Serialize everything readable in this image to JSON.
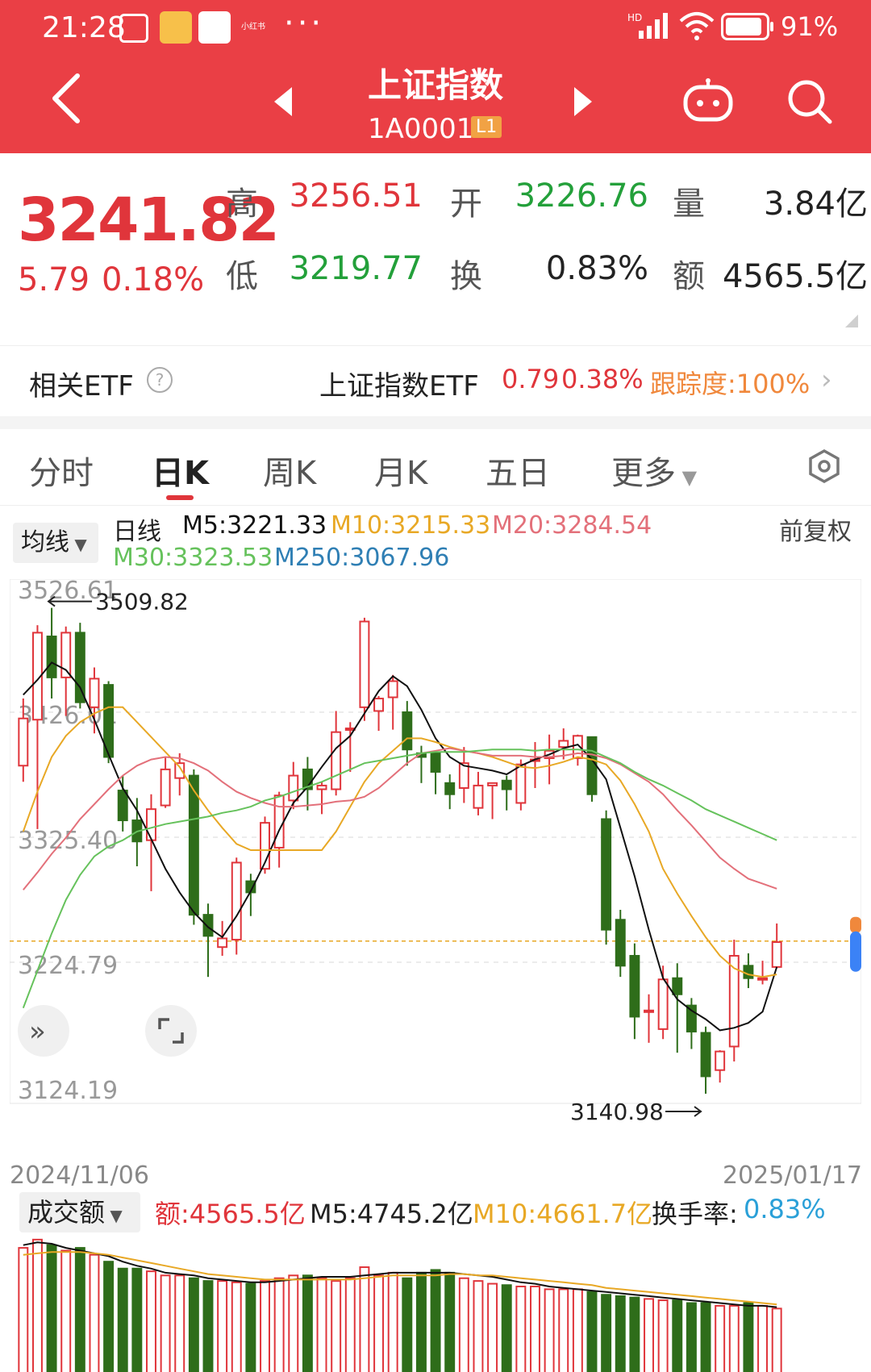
{
  "status_bar": {
    "time": "21:28",
    "battery": "91%",
    "network": "HD",
    "app_label": "小红书"
  },
  "header": {
    "title": "上证指数",
    "code": "1A0001",
    "level": "L1"
  },
  "quote": {
    "price": "3241.82",
    "change": "5.79",
    "change_pct": "0.18%",
    "high_label": "高",
    "high": "3256.51",
    "open_label": "开",
    "open": "3226.76",
    "vol_label": "量",
    "volume": "3.84亿",
    "low_label": "低",
    "low": "3219.77",
    "turnover_label": "换",
    "turnover": "0.83%",
    "amount_label": "额",
    "amount": "4565.5亿"
  },
  "etf": {
    "label": "相关ETF",
    "name": "上证指数ETF",
    "price": "0.79",
    "pct": "0.38%",
    "tracking": "跟踪度:100%"
  },
  "tabs": [
    "分时",
    "日K",
    "周K",
    "月K",
    "五日",
    "更多"
  ],
  "ma_legend": {
    "selector": "均线",
    "period": "日线",
    "m5": "M5:3221.33",
    "m10": "M10:3215.33",
    "m20": "M20:3284.54",
    "m30": "M30:3323.53",
    "m250": "M250:3067.96",
    "adjust": "前复权"
  },
  "colors": {
    "up": "#e0353b",
    "down": "#2e6d1a",
    "m5": "#111111",
    "m10": "#e8a825",
    "m20": "#e3707a",
    "m30": "#66c25c",
    "m250": "#2f7fb4"
  },
  "chart_data": {
    "type": "candlestick",
    "y_ticks": [
      "3526.61",
      "3426.01",
      "3325.40",
      "3224.79",
      "3124.19"
    ],
    "ylim": [
      3124.19,
      3526.61
    ],
    "high_annotation": "3509.82",
    "low_annotation": "3140.98",
    "last_price": 3241.82,
    "x_start": "2024/11/06",
    "x_end": "2025/01/17",
    "candles": [
      [
        3383,
        3421,
        3370,
        3437
      ],
      [
        3420,
        3490,
        3332,
        3496
      ],
      [
        3487,
        3454,
        3437,
        3510
      ],
      [
        3454,
        3490,
        3423,
        3495
      ],
      [
        3490,
        3434,
        3429,
        3498
      ],
      [
        3430,
        3453,
        3409,
        3462
      ],
      [
        3448,
        3390,
        3385,
        3451
      ],
      [
        3363,
        3339,
        3330,
        3375
      ],
      [
        3339,
        3322,
        3302,
        3357
      ],
      [
        3323,
        3348,
        3282,
        3360
      ],
      [
        3351,
        3380,
        3349,
        3390
      ],
      [
        3373,
        3385,
        3359,
        3393
      ],
      [
        3375,
        3263,
        3255,
        3380
      ],
      [
        3263,
        3246,
        3213,
        3272
      ],
      [
        3237,
        3244,
        3230,
        3258
      ],
      [
        3243,
        3305,
        3231,
        3309
      ],
      [
        3290,
        3281,
        3262,
        3296
      ],
      [
        3300,
        3337,
        3296,
        3342
      ],
      [
        3317,
        3359,
        3301,
        3362
      ],
      [
        3355,
        3375,
        3348,
        3386
      ],
      [
        3380,
        3364,
        3347,
        3390
      ],
      [
        3364,
        3367,
        3344,
        3370
      ],
      [
        3364,
        3410,
        3359,
        3427
      ],
      [
        3412,
        3413,
        3378,
        3418
      ],
      [
        3430,
        3499,
        3419,
        3502
      ],
      [
        3427,
        3437,
        3411,
        3439
      ],
      [
        3438,
        3451,
        3412,
        3456
      ],
      [
        3426,
        3396,
        3383,
        3435
      ],
      [
        3393,
        3390,
        3369,
        3399
      ],
      [
        3393,
        3378,
        3360,
        3395
      ],
      [
        3369,
        3360,
        3348,
        3376
      ],
      [
        3365,
        3385,
        3353,
        3398
      ],
      [
        3349,
        3367,
        3343,
        3378
      ],
      [
        3367,
        3369,
        3340,
        3369
      ],
      [
        3371,
        3364,
        3347,
        3375
      ],
      [
        3353,
        3384,
        3347,
        3388
      ],
      [
        3387,
        3388,
        3365,
        3402
      ],
      [
        3389,
        3395,
        3368,
        3408
      ],
      [
        3398,
        3403,
        3388,
        3413
      ],
      [
        3389,
        3407,
        3383,
        3408
      ],
      [
        3406,
        3360,
        3354,
        3406
      ],
      [
        3340,
        3251,
        3239,
        3347
      ],
      [
        3259,
        3222,
        3213,
        3267
      ],
      [
        3230,
        3181,
        3163,
        3240
      ],
      [
        3185,
        3186,
        3160,
        3199
      ],
      [
        3171,
        3211,
        3163,
        3222
      ],
      [
        3212,
        3199,
        3152,
        3224
      ],
      [
        3190,
        3169,
        3155,
        3196
      ],
      [
        3168,
        3133,
        3119,
        3173
      ],
      [
        3138,
        3153,
        3128,
        3154
      ],
      [
        3157,
        3230,
        3145,
        3243
      ],
      [
        3222,
        3212,
        3204,
        3232
      ],
      [
        3212,
        3212,
        3207,
        3226
      ],
      [
        3221,
        3241,
        3220,
        3256
      ]
    ],
    "ma_series": {
      "M5": [
        3440,
        3452,
        3466,
        3460,
        3446,
        3420,
        3392,
        3365,
        3347,
        3324,
        3300,
        3281,
        3265,
        3253,
        3245,
        3262,
        3282,
        3305,
        3331,
        3353,
        3366,
        3382,
        3397,
        3407,
        3425,
        3443,
        3455,
        3447,
        3428,
        3405,
        3390,
        3383,
        3381,
        3379,
        3376,
        3383,
        3388,
        3392,
        3397,
        3400,
        3388,
        3372,
        3333,
        3294,
        3251,
        3212,
        3195,
        3186,
        3179,
        3170,
        3172,
        3176,
        3185,
        3221
      ],
      "M10": [
        3330,
        3362,
        3390,
        3407,
        3418,
        3425,
        3430,
        3430,
        3418,
        3406,
        3394,
        3382,
        3363,
        3347,
        3333,
        3320,
        3315,
        3315,
        3315,
        3315,
        3315,
        3315,
        3330,
        3350,
        3370,
        3385,
        3395,
        3405,
        3405,
        3402,
        3398,
        3395,
        3393,
        3390,
        3386,
        3382,
        3381,
        3383,
        3386,
        3390,
        3388,
        3384,
        3371,
        3352,
        3330,
        3300,
        3280,
        3262,
        3245,
        3230,
        3220,
        3215,
        3213,
        3215
      ],
      "M20": [
        3283,
        3297,
        3312,
        3325,
        3340,
        3352,
        3364,
        3375,
        3383,
        3388,
        3390,
        3389,
        3385,
        3379,
        3370,
        3362,
        3357,
        3353,
        3350,
        3350,
        3351,
        3352,
        3354,
        3355,
        3358,
        3365,
        3375,
        3385,
        3393,
        3395,
        3397,
        3395,
        3393,
        3391,
        3391,
        3391,
        3390,
        3390,
        3391,
        3393,
        3392,
        3389,
        3384,
        3377,
        3370,
        3360,
        3347,
        3335,
        3322,
        3309,
        3300,
        3292,
        3288,
        3284
      ],
      "M30": [
        3188,
        3218,
        3248,
        3275,
        3295,
        3310,
        3318,
        3323,
        3330,
        3333,
        3336,
        3338,
        3340,
        3342,
        3345,
        3347,
        3350,
        3355,
        3358,
        3362,
        3366,
        3370,
        3375,
        3380,
        3385,
        3387,
        3389,
        3391,
        3393,
        3394,
        3394,
        3394,
        3395,
        3396,
        3396,
        3396,
        3395,
        3396,
        3396,
        3396,
        3395,
        3390,
        3385,
        3378,
        3372,
        3367,
        3361,
        3355,
        3348,
        3343,
        3338,
        3333,
        3328,
        3323
      ]
    }
  },
  "volume": {
    "selector": "成交额",
    "amount": "额:4565.5亿",
    "m5": "M5:4745.2亿",
    "m10": "M10:4661.7亿",
    "turnover_label": "换手率:",
    "turnover": "0.83%",
    "values": [
      90,
      96,
      92,
      88,
      90,
      85,
      80,
      75,
      75,
      73,
      70,
      70,
      68,
      66,
      66,
      65,
      64,
      66,
      68,
      70,
      70,
      68,
      66,
      68,
      76,
      70,
      72,
      68,
      72,
      74,
      72,
      68,
      66,
      64,
      63,
      62,
      62,
      60,
      60,
      60,
      58,
      56,
      55,
      54,
      53,
      52,
      52,
      50,
      50,
      48,
      48,
      50,
      48,
      46
    ],
    "ma5": [
      92,
      94,
      93,
      90,
      88,
      86,
      84,
      80,
      77,
      75,
      72,
      71,
      70,
      68,
      67,
      66,
      65,
      65,
      66,
      67,
      68,
      69,
      69,
      69,
      70,
      71,
      72,
      72,
      72,
      72,
      72,
      71,
      70,
      69,
      67,
      65,
      64,
      62,
      61,
      60,
      59,
      58,
      57,
      56,
      55,
      54,
      53,
      52,
      51,
      50,
      49,
      48,
      48,
      47
    ],
    "ma10": [
      85,
      86,
      87,
      87,
      87,
      86,
      85,
      83,
      81,
      79,
      77,
      75,
      73,
      71,
      70,
      69,
      68,
      67,
      67,
      67,
      67,
      67,
      67,
      67,
      68,
      69,
      70,
      70,
      70,
      70,
      71,
      71,
      70,
      70,
      69,
      68,
      67,
      66,
      65,
      64,
      63,
      61,
      60,
      59,
      58,
      57,
      56,
      55,
      54,
      53,
      52,
      51,
      50,
      49
    ]
  }
}
